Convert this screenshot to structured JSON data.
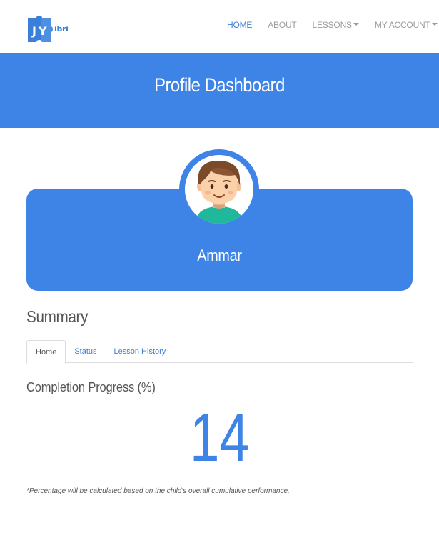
{
  "brand": {
    "logo_text": "ibri",
    "colors": {
      "primary": "#3e84e6",
      "link": "#3a7fd8",
      "nav_inactive": "#9b9b9b",
      "text": "#555555"
    }
  },
  "nav": {
    "items": [
      {
        "label": "HOME",
        "active": true,
        "dropdown": false
      },
      {
        "label": "ABOUT",
        "active": false,
        "dropdown": false
      },
      {
        "label": "LESSONS",
        "active": false,
        "dropdown": true
      },
      {
        "label": "MY ACCOUNT",
        "active": false,
        "dropdown": true
      }
    ]
  },
  "banner": {
    "title": "Profile Dashboard"
  },
  "profile": {
    "name": "Ammar",
    "avatar_icon": "boy-avatar-icon"
  },
  "summary": {
    "heading": "Summary",
    "tabs": [
      {
        "label": "Home",
        "active": true
      },
      {
        "label": "Status",
        "active": false
      },
      {
        "label": "Lesson History",
        "active": false
      }
    ],
    "progress_heading": "Completion Progress (%)",
    "progress_value": "14",
    "footnote": "*Percentage will be calculated based on the child's overall cumulative performance."
  }
}
